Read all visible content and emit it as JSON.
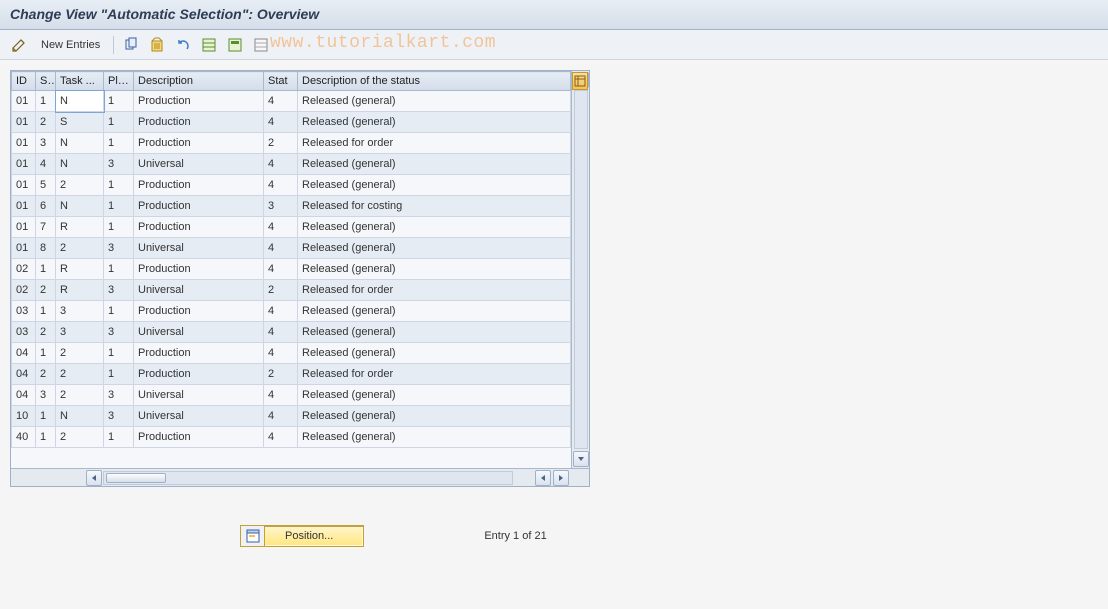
{
  "title": "Change View \"Automatic Selection\": Overview",
  "toolbar": {
    "new_entries": "New Entries"
  },
  "watermark": "www.tutorialkart.com",
  "table": {
    "headers": {
      "id": "ID",
      "sp": "SP",
      "task": "Task ...",
      "pla": "Pla...",
      "desc": "Description",
      "stat": "Stat",
      "stdesc": "Description of the status"
    },
    "rows": [
      {
        "id": "01",
        "sp": "1",
        "task": "N",
        "pla": "1",
        "desc": "Production",
        "stat": "4",
        "stdesc": "Released (general)"
      },
      {
        "id": "01",
        "sp": "2",
        "task": "S",
        "pla": "1",
        "desc": "Production",
        "stat": "4",
        "stdesc": "Released (general)"
      },
      {
        "id": "01",
        "sp": "3",
        "task": "N",
        "pla": "1",
        "desc": "Production",
        "stat": "2",
        "stdesc": "Released for order"
      },
      {
        "id": "01",
        "sp": "4",
        "task": "N",
        "pla": "3",
        "desc": "Universal",
        "stat": "4",
        "stdesc": "Released (general)"
      },
      {
        "id": "01",
        "sp": "5",
        "task": "2",
        "pla": "1",
        "desc": "Production",
        "stat": "4",
        "stdesc": "Released (general)"
      },
      {
        "id": "01",
        "sp": "6",
        "task": "N",
        "pla": "1",
        "desc": "Production",
        "stat": "3",
        "stdesc": "Released for costing"
      },
      {
        "id": "01",
        "sp": "7",
        "task": "R",
        "pla": "1",
        "desc": "Production",
        "stat": "4",
        "stdesc": "Released (general)"
      },
      {
        "id": "01",
        "sp": "8",
        "task": "2",
        "pla": "3",
        "desc": "Universal",
        "stat": "4",
        "stdesc": "Released (general)"
      },
      {
        "id": "02",
        "sp": "1",
        "task": "R",
        "pla": "1",
        "desc": "Production",
        "stat": "4",
        "stdesc": "Released (general)"
      },
      {
        "id": "02",
        "sp": "2",
        "task": "R",
        "pla": "3",
        "desc": "Universal",
        "stat": "2",
        "stdesc": "Released for order"
      },
      {
        "id": "03",
        "sp": "1",
        "task": "3",
        "pla": "1",
        "desc": "Production",
        "stat": "4",
        "stdesc": "Released (general)"
      },
      {
        "id": "03",
        "sp": "2",
        "task": "3",
        "pla": "3",
        "desc": "Universal",
        "stat": "4",
        "stdesc": "Released (general)"
      },
      {
        "id": "04",
        "sp": "1",
        "task": "2",
        "pla": "1",
        "desc": "Production",
        "stat": "4",
        "stdesc": "Released (general)"
      },
      {
        "id": "04",
        "sp": "2",
        "task": "2",
        "pla": "1",
        "desc": "Production",
        "stat": "2",
        "stdesc": "Released for order"
      },
      {
        "id": "04",
        "sp": "3",
        "task": "2",
        "pla": "3",
        "desc": "Universal",
        "stat": "4",
        "stdesc": "Released (general)"
      },
      {
        "id": "10",
        "sp": "1",
        "task": "N",
        "pla": "3",
        "desc": "Universal",
        "stat": "4",
        "stdesc": "Released (general)"
      },
      {
        "id": "40",
        "sp": "1",
        "task": "2",
        "pla": "1",
        "desc": "Production",
        "stat": "4",
        "stdesc": "Released (general)"
      }
    ]
  },
  "footer": {
    "position": "Position...",
    "entry_status": "Entry 1 of 21"
  }
}
